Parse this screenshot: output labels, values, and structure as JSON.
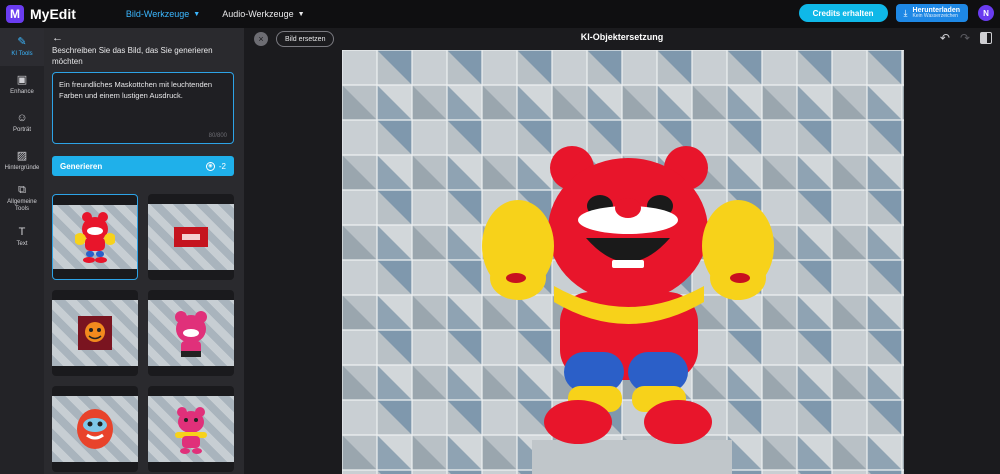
{
  "app": {
    "name": "MyEdit",
    "logo_letter": "M"
  },
  "nav": {
    "items": [
      {
        "label": "Bild-Werkzeuge",
        "active": true
      },
      {
        "label": "Audio-Werkzeuge",
        "active": false
      }
    ]
  },
  "header": {
    "credits_label": "Credits erhalten",
    "download_label": "Herunterladen",
    "download_sub": "Kein Wasserzeichen",
    "avatar_initial": "N"
  },
  "rail": {
    "items": [
      {
        "label": "KI Tools",
        "icon": "magic-wand-icon",
        "glyph": "✎",
        "active": true
      },
      {
        "label": "Enhance",
        "icon": "enhance-icon",
        "glyph": "▣",
        "active": false
      },
      {
        "label": "Porträt",
        "icon": "portrait-icon",
        "glyph": "☺",
        "active": false
      },
      {
        "label": "Hintergründe",
        "icon": "background-icon",
        "glyph": "▨",
        "active": false
      },
      {
        "label": "Allgemeine Tools",
        "icon": "general-tools-icon",
        "glyph": "⧉",
        "active": false
      },
      {
        "label": "Text",
        "icon": "text-icon",
        "glyph": "T",
        "active": false
      }
    ]
  },
  "panel": {
    "prompt_label": "Beschreiben Sie das Bild, das Sie generieren möchten",
    "prompt_value": "Ein freundliches Maskottchen mit leuchtenden Farben und einem lustigen Ausdruck.",
    "prompt_count": "80/800",
    "generate_label": "Generieren",
    "generate_cost": "-2"
  },
  "canvas": {
    "replace_label": "Bild ersetzen",
    "title": "KI-Objektersetzung"
  },
  "colors": {
    "accent": "#1fb0ea",
    "brand": "#6a3cf0",
    "mascot_red": "#e8152b",
    "mascot_yellow": "#f7d21a",
    "mascot_blue": "#2b5fc8"
  }
}
